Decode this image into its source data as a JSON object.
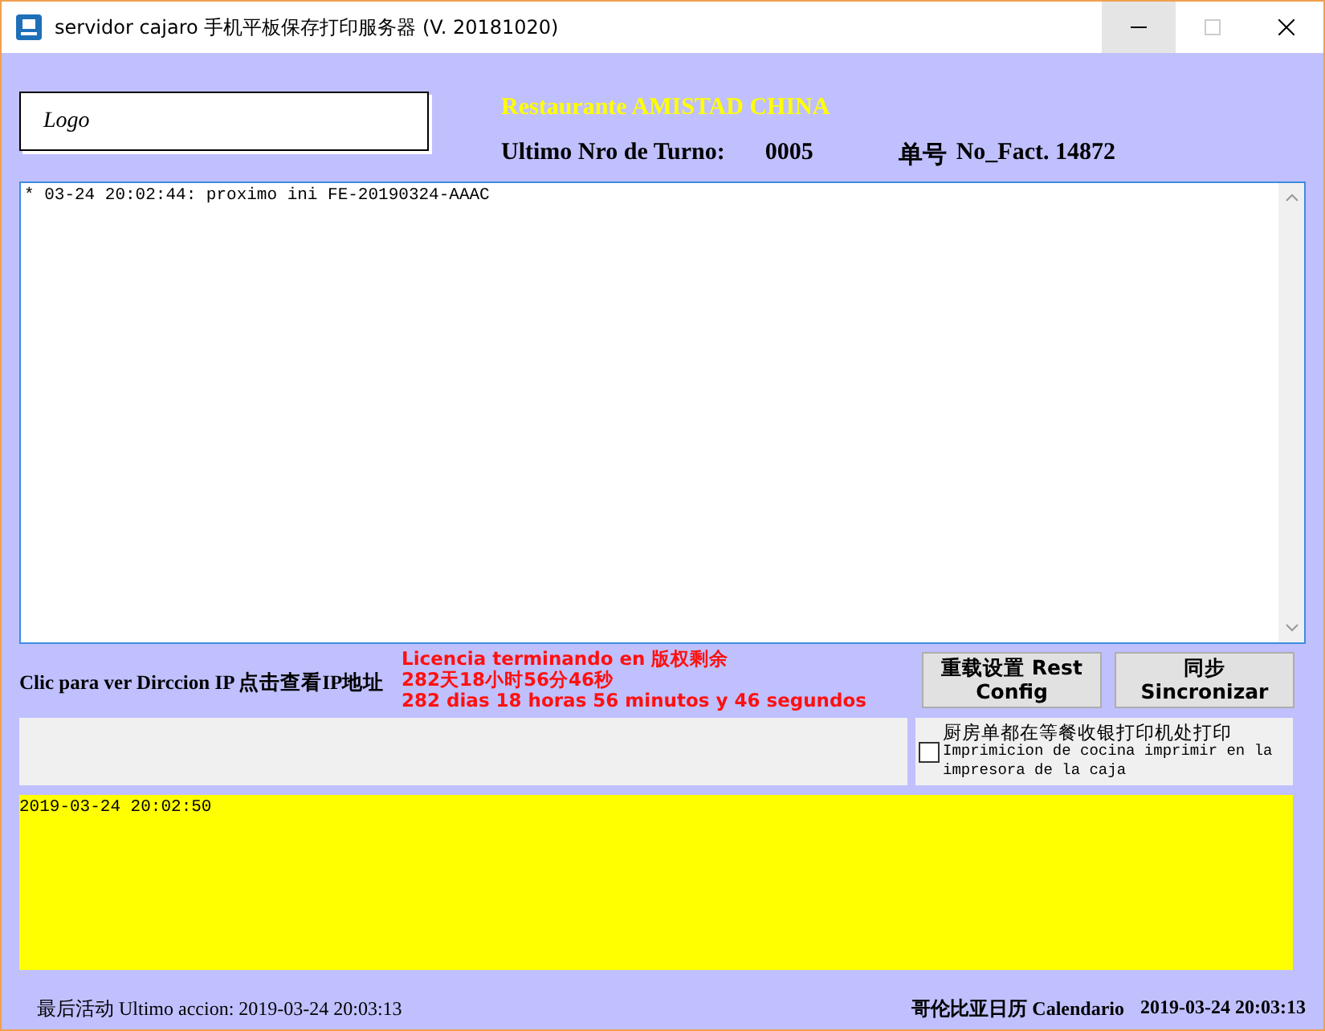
{
  "window": {
    "title": "servidor cajaro 手机平板保存打印服务器 (V. 20181020)"
  },
  "logo": {
    "text": "Logo"
  },
  "header": {
    "restaurant": "Restaurante AMISTAD CHINA",
    "turn_label": "Ultimo Nro de Turno:",
    "turn_value": "0005",
    "invoice_label_cn": "单号",
    "invoice_label": "No_Fact. 14872"
  },
  "log": {
    "lines": [
      "* 03-24 20:02:44: proximo ini FE-20190324-AAAC"
    ]
  },
  "ip_link": "Clic para ver Dirccion IP 点击查看IP地址",
  "license": [
    "Licencia terminando en 版权剩余",
    "282天18小时56分46秒",
    "282 dias 18 horas 56 minutos y 46 segundos"
  ],
  "buttons": [
    {
      "label": "重载设置 Rest Config"
    },
    {
      "label": "同步 Sincronizar"
    }
  ],
  "kitchen_option": {
    "label_cn": "厨房单都在等餐收银打印机处打印",
    "label": "Imprimicion de cocina imprimir en la impresora de la caja",
    "checked": false
  },
  "event_log": {
    "lines": [
      "2019-03-24 20:02:50"
    ]
  },
  "status_bar": {
    "last_action": "最后活动 Ultimo accion: 2019-03-24 20:03:13",
    "calendar_label": "哥伦比亚日历 Calendario",
    "calendar_time": "2019-03-24 20:03:13"
  }
}
